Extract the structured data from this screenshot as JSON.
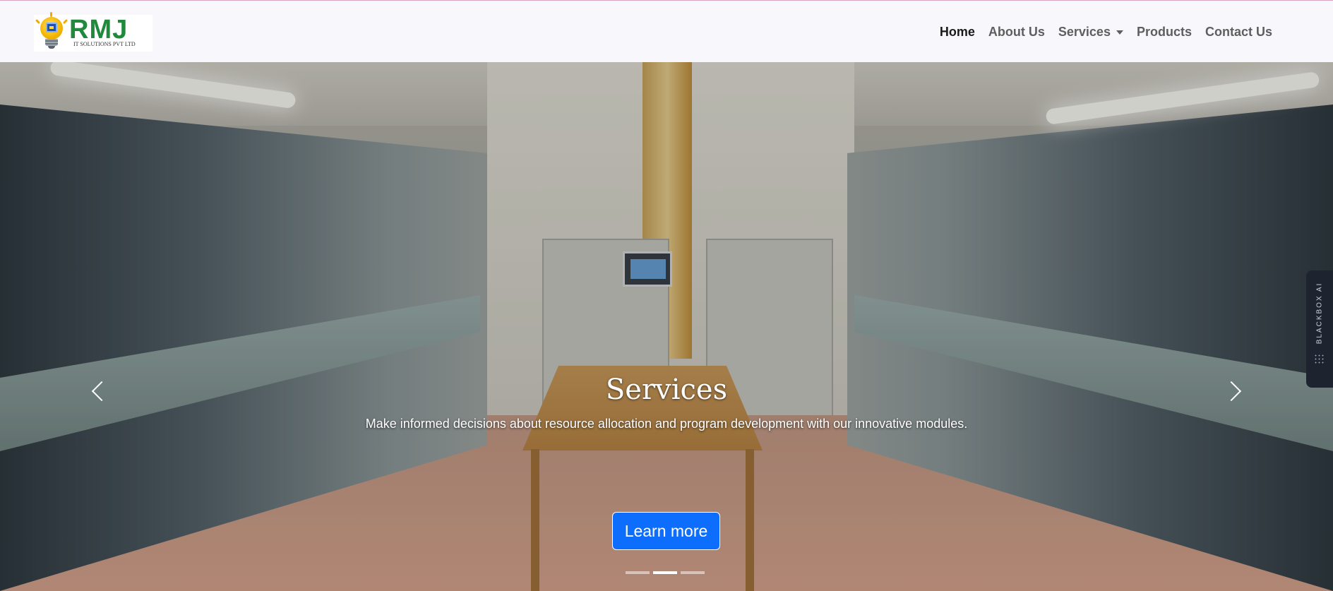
{
  "brand": {
    "name": "RMJ",
    "tagline": "IT SOLUTIONS PVT LTD"
  },
  "nav": {
    "home": "Home",
    "about": "About Us",
    "services": "Services",
    "products": "Products",
    "contact": "Contact Us"
  },
  "hero": {
    "title": "Services",
    "text": "Make informed decisions about resource allocation and program development with our innovative modules.",
    "cta": "Learn more",
    "active_slide": 2,
    "slide_count": 3
  },
  "side_tab": {
    "label": "BLACKBOX AI"
  },
  "colors": {
    "primary": "#0d6efd",
    "brand_green": "#1f8a3b",
    "navbar_bg": "#f8f7fb"
  }
}
